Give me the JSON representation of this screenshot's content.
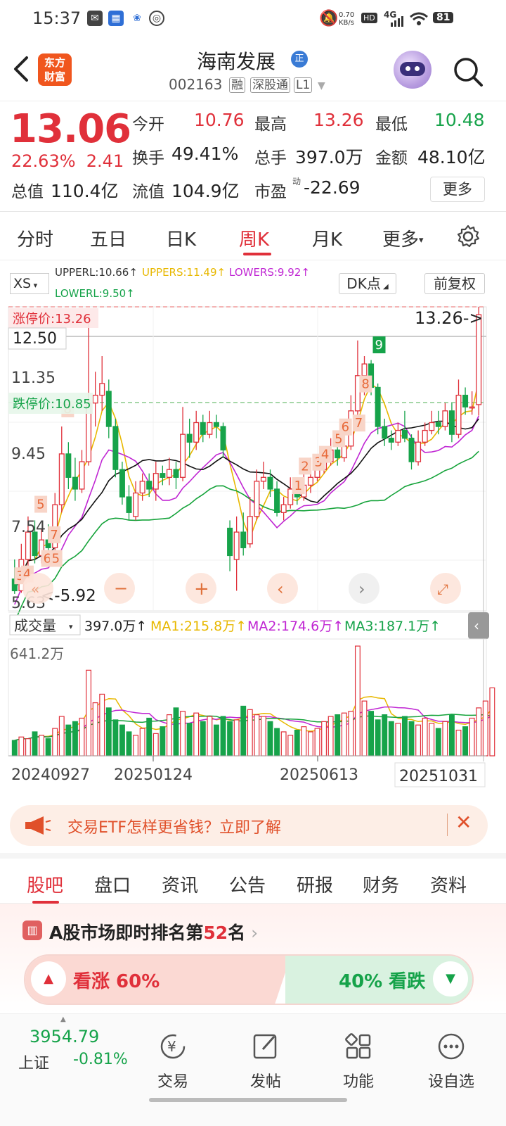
{
  "status_bar": {
    "time": "15:37",
    "net_speed_top": "0.70",
    "net_speed_unit": "KB/s",
    "hd": "HD",
    "signal": "4G",
    "battery": "81"
  },
  "header": {
    "logo_line1": "东方",
    "logo_line2": "财富",
    "stock_name": "海南发展",
    "verify_badge": "正",
    "stock_code": "002163",
    "tag_margin": "融",
    "tag_connect": "深股通",
    "tag_level": "L1"
  },
  "quote": {
    "price": "13.06",
    "change_pct": "22.63%",
    "change_amt": "2.41",
    "open_label": "今开",
    "open": "10.76",
    "high_label": "最高",
    "high": "13.26",
    "low_label": "最低",
    "low": "10.48",
    "turnover_label": "换手",
    "turnover": "49.41%",
    "volume_label": "总手",
    "volume": "397.0万",
    "amount_label": "金额",
    "amount": "48.10亿",
    "mktcap_label": "总值",
    "mktcap": "110.4亿",
    "float_label": "流值",
    "float": "104.9亿",
    "pe_label": "市盈",
    "pe_sup": "动",
    "pe": "-22.69",
    "more_label": "更多"
  },
  "period_tabs": {
    "items": [
      "分时",
      "五日",
      "日K",
      "周K",
      "月K",
      "更多"
    ],
    "active": "周K"
  },
  "chart_controls": {
    "indicator_select": "XS",
    "upperl": "UPPERL:10.66↑",
    "uppers": "UPPERS:11.49↑",
    "lowers": "LOWERS:9.92↑",
    "lowerl": "LOWERL:9.50↑",
    "dk_label": "DK点",
    "fq_label": "前复权",
    "limit_up_label": "涨停价:13.26",
    "limit_down_label": "跌停价:10.85",
    "last_marker": "13.26->",
    "low_marker": "<-5.92",
    "vol_select": "成交量",
    "vol_value": "397.0万↑",
    "ma1": "MA1:215.8万↑",
    "ma2": "MA2:174.6万↑",
    "ma3": "MA3:187.1万↑",
    "vol_axis_top": "641.2万"
  },
  "chart_data": {
    "type": "candlestick",
    "price_axis_labels": [
      "12.50",
      "11.35",
      "9.45",
      "7.54",
      "5.63"
    ],
    "date_labels": [
      "20240927",
      "20250124",
      "20250613",
      "20251031"
    ],
    "dk_markers_low": [
      "3",
      "4",
      "5",
      "6",
      "7",
      "5",
      "8"
    ],
    "dk_markers_high": [
      "1",
      "2",
      "3",
      "4",
      "5",
      "6",
      "7",
      "8",
      "9"
    ],
    "candles": [
      {
        "o": 6.3,
        "c": 6.0,
        "h": 6.8,
        "l": 5.92
      },
      {
        "o": 6.0,
        "c": 6.8,
        "h": 7.2,
        "l": 5.95
      },
      {
        "o": 6.8,
        "c": 7.5,
        "h": 7.9,
        "l": 6.5
      },
      {
        "o": 7.5,
        "c": 6.9,
        "h": 7.8,
        "l": 6.7
      },
      {
        "o": 6.9,
        "c": 7.3,
        "h": 7.6,
        "l": 6.7
      },
      {
        "o": 7.3,
        "c": 7.1,
        "h": 7.7,
        "l": 6.9
      },
      {
        "o": 7.1,
        "c": 8.2,
        "h": 8.5,
        "l": 7.0
      },
      {
        "o": 8.2,
        "c": 9.5,
        "h": 10.2,
        "l": 8.0
      },
      {
        "o": 9.5,
        "c": 8.9,
        "h": 9.8,
        "l": 8.6
      },
      {
        "o": 8.9,
        "c": 8.6,
        "h": 9.4,
        "l": 8.3
      },
      {
        "o": 8.6,
        "c": 9.3,
        "h": 9.6,
        "l": 8.5
      },
      {
        "o": 9.3,
        "c": 10.8,
        "h": 12.9,
        "l": 9.2
      },
      {
        "o": 10.8,
        "c": 11.0,
        "h": 11.6,
        "l": 10.2
      },
      {
        "o": 11.0,
        "c": 11.3,
        "h": 12.0,
        "l": 10.6
      },
      {
        "o": 11.1,
        "c": 10.2,
        "h": 11.4,
        "l": 9.9
      },
      {
        "o": 10.2,
        "c": 9.1,
        "h": 10.4,
        "l": 8.9
      },
      {
        "o": 9.1,
        "c": 8.4,
        "h": 9.3,
        "l": 8.2
      },
      {
        "o": 8.4,
        "c": 8.0,
        "h": 8.7,
        "l": 7.8
      },
      {
        "o": 7.9,
        "c": 8.5,
        "h": 8.8,
        "l": 7.8
      },
      {
        "o": 8.5,
        "c": 8.8,
        "h": 9.0,
        "l": 8.3
      },
      {
        "o": 8.8,
        "c": 8.6,
        "h": 9.0,
        "l": 8.4
      },
      {
        "o": 8.6,
        "c": 9.0,
        "h": 9.3,
        "l": 8.3
      },
      {
        "o": 9.0,
        "c": 8.9,
        "h": 9.2,
        "l": 8.7
      },
      {
        "o": 8.9,
        "c": 9.1,
        "h": 9.4,
        "l": 8.7
      },
      {
        "o": 9.1,
        "c": 8.9,
        "h": 9.3,
        "l": 8.6
      },
      {
        "o": 8.9,
        "c": 10.0,
        "h": 10.7,
        "l": 8.8
      },
      {
        "o": 10.0,
        "c": 9.8,
        "h": 10.4,
        "l": 9.4
      },
      {
        "o": 9.8,
        "c": 10.3,
        "h": 10.6,
        "l": 9.6
      },
      {
        "o": 10.3,
        "c": 10.0,
        "h": 10.5,
        "l": 9.8
      },
      {
        "o": 10.0,
        "c": 10.3,
        "h": 10.6,
        "l": 9.9
      },
      {
        "o": 10.3,
        "c": 10.2,
        "h": 10.5,
        "l": 9.9
      },
      {
        "o": 10.2,
        "c": 9.6,
        "h": 10.3,
        "l": 9.4
      },
      {
        "o": 7.6,
        "c": 6.9,
        "h": 7.8,
        "l": 6.5
      },
      {
        "o": 6.8,
        "c": 7.5,
        "h": 7.9,
        "l": 6.0
      },
      {
        "o": 7.5,
        "c": 7.1,
        "h": 8.0,
        "l": 6.9
      },
      {
        "o": 7.2,
        "c": 7.9,
        "h": 8.4,
        "l": 7.1
      },
      {
        "o": 7.9,
        "c": 8.8,
        "h": 9.1,
        "l": 7.8
      },
      {
        "o": 8.8,
        "c": 8.9,
        "h": 9.3,
        "l": 8.6
      },
      {
        "o": 8.9,
        "c": 8.6,
        "h": 9.1,
        "l": 8.4
      },
      {
        "o": 8.6,
        "c": 8.0,
        "h": 8.8,
        "l": 7.9
      },
      {
        "o": 8.0,
        "c": 8.2,
        "h": 8.4,
        "l": 7.8
      },
      {
        "o": 8.2,
        "c": 8.6,
        "h": 8.9,
        "l": 8.1
      },
      {
        "o": 8.6,
        "c": 8.4,
        "h": 8.8,
        "l": 8.2
      },
      {
        "o": 8.4,
        "c": 8.7,
        "h": 9.0,
        "l": 8.3
      },
      {
        "o": 8.7,
        "c": 8.9,
        "h": 9.2,
        "l": 8.5
      },
      {
        "o": 8.9,
        "c": 9.1,
        "h": 9.4,
        "l": 8.8
      },
      {
        "o": 9.1,
        "c": 9.3,
        "h": 9.6,
        "l": 9.0
      },
      {
        "o": 9.3,
        "c": 9.6,
        "h": 9.9,
        "l": 9.2
      },
      {
        "o": 9.6,
        "c": 9.4,
        "h": 9.8,
        "l": 9.2
      },
      {
        "o": 9.4,
        "c": 9.7,
        "h": 10.0,
        "l": 9.3
      },
      {
        "o": 9.7,
        "c": 10.6,
        "h": 11.0,
        "l": 9.6
      },
      {
        "o": 10.6,
        "c": 11.5,
        "h": 12.4,
        "l": 10.4
      },
      {
        "o": 11.5,
        "c": 11.8,
        "h": 12.0,
        "l": 11.0
      },
      {
        "o": 11.8,
        "c": 11.2,
        "h": 11.9,
        "l": 11.0
      },
      {
        "o": 11.2,
        "c": 10.2,
        "h": 11.3,
        "l": 10.0
      },
      {
        "o": 10.2,
        "c": 9.9,
        "h": 10.4,
        "l": 9.7
      },
      {
        "o": 9.9,
        "c": 9.8,
        "h": 10.1,
        "l": 9.6
      },
      {
        "o": 9.8,
        "c": 10.1,
        "h": 10.3,
        "l": 9.7
      },
      {
        "o": 10.1,
        "c": 9.9,
        "h": 10.6,
        "l": 9.8
      },
      {
        "o": 9.9,
        "c": 9.3,
        "h": 10.0,
        "l": 9.1
      },
      {
        "o": 9.3,
        "c": 9.8,
        "h": 10.1,
        "l": 9.2
      },
      {
        "o": 9.8,
        "c": 10.1,
        "h": 10.3,
        "l": 9.7
      },
      {
        "o": 10.1,
        "c": 10.3,
        "h": 10.6,
        "l": 10.0
      },
      {
        "o": 10.3,
        "c": 10.2,
        "h": 10.6,
        "l": 10.0
      },
      {
        "o": 10.2,
        "c": 10.6,
        "h": 10.8,
        "l": 10.1
      },
      {
        "o": 10.6,
        "c": 10.0,
        "h": 10.8,
        "l": 9.8
      },
      {
        "o": 10.0,
        "c": 11.0,
        "h": 11.4,
        "l": 9.9
      },
      {
        "o": 11.0,
        "c": 10.7,
        "h": 11.2,
        "l": 10.5
      },
      {
        "o": 10.7,
        "c": 10.7,
        "h": 11.1,
        "l": 10.5
      },
      {
        "o": 10.76,
        "c": 13.06,
        "h": 13.26,
        "l": 10.48
      }
    ],
    "volumes": [
      0.9,
      1.1,
      1.0,
      1.4,
      1.2,
      1.0,
      1.6,
      2.3,
      1.8,
      2.0,
      2.2,
      5.0,
      3.1,
      3.6,
      2.8,
      2.1,
      1.8,
      1.4,
      1.2,
      1.6,
      2.2,
      1.3,
      1.7,
      2.4,
      2.8,
      2.6,
      1.9,
      2.5,
      2.0,
      2.3,
      1.8,
      2.3,
      2.0,
      2.1,
      2.9,
      2.7,
      2.4,
      2.3,
      2.0,
      1.6,
      1.4,
      1.2,
      1.5,
      1.7,
      1.4,
      1.6,
      2.0,
      2.3,
      2.4,
      2.5,
      2.6,
      6.41,
      3.2,
      2.6,
      2.1,
      2.4,
      2.0,
      1.9,
      2.3,
      2.0,
      1.8,
      2.2,
      1.9,
      1.6,
      2.0,
      2.4,
      1.5,
      1.7,
      2.2,
      2.8,
      3.2,
      3.97
    ],
    "volume_unit": "百万",
    "vol_ylim": [
      0,
      6.412
    ]
  },
  "banner": {
    "text": "交易ETF怎样更省钱？立即了解"
  },
  "bottom_tabs": {
    "items": [
      "股吧",
      "盘口",
      "资讯",
      "公告",
      "研报",
      "财务",
      "资料"
    ],
    "active": "股吧"
  },
  "ranking": {
    "prefix": "A股市场即时排名第",
    "rank": "52",
    "suffix": "名",
    "bull_label": "看涨 60%",
    "bear_label": "40% 看跌",
    "bull_pct": 60
  },
  "bottom_nav": {
    "index_value": "3954.79",
    "index_name": "上证",
    "index_change": "-0.81%",
    "items": [
      "交易",
      "发帖",
      "功能",
      "设自选"
    ]
  },
  "colors": {
    "up": "#e0303a",
    "down": "#16a34a",
    "ma_yellow": "#e8b800",
    "ma_purple": "#c026d3",
    "ma_black": "#111111",
    "ma_green": "#15a33a"
  }
}
